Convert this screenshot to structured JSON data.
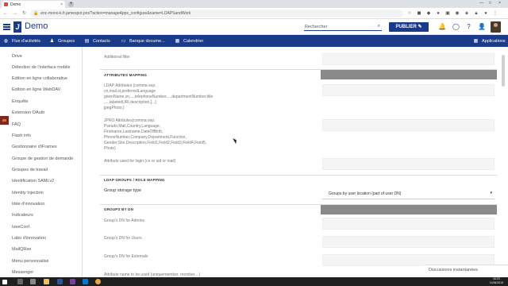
{
  "browser": {
    "tab_title": "Demo",
    "tab_close": "×",
    "new_tab": "+",
    "url": "enc-mono-k.fr.jamespot.pro/?action=manageApps_configure&name=LDAPSandWork",
    "controls": [
      "—",
      "□",
      "×"
    ]
  },
  "header": {
    "app_name": "Demo",
    "logo_letter": "J",
    "search_placeholder": "Rechercher",
    "publish_label": "PUBLIER"
  },
  "nav": {
    "items": [
      {
        "label": "Flux d'activités",
        "icon": "globe-icon"
      },
      {
        "label": "Groupes",
        "icon": "groups-icon"
      },
      {
        "label": "Contacts",
        "icon": "contacts-icon"
      },
      {
        "label": "Banque docume...",
        "icon": "folder-icon"
      },
      {
        "label": "Calendrier",
        "icon": "calendar-icon"
      }
    ],
    "apps_label": "Applications"
  },
  "sidebar": {
    "items": [
      "Drive",
      "Détection de l'interface mobile",
      "Edition en ligne collaborative",
      "Edition en ligne WebDAV",
      "Enquête",
      "Extension OAuth",
      "FAQ",
      "Flash info",
      "Gestionnaire d'iFrames",
      "Groupe de gestion de demande",
      "Groupes de travail",
      "Identification SAMLv2",
      "Identity Injection",
      "Idée d'innovation",
      "Indicateurs",
      "IzeeConf",
      "Labo d'innovation",
      "MailQRee",
      "Menu personnalisé",
      "Messenger"
    ]
  },
  "main": {
    "additional_filter": "Additional filter",
    "attributes_mapping": "ATTRIBUTES MAPPING",
    "ldap_attr_lines": [
      "LDAP Attributes (comma sep.",
      "cn,mail,st,preferredLanguage",
      "givenName,sn,...,telephoneNumber,...,departmentNumber,title",
      ",...,labeledURI,description,[...]",
      "jpegPhoto.)"
    ],
    "jpro_attr_lines": [
      "JPRO Attributes(comma sep.",
      "Pseudo,Mail,Country,Language,",
      "Firstname,Lastname,DateOfBirth,",
      "PhoneNumber,Company,Department,Function,",
      "Gender,Site,Description,Field1,Field2,Field3,Field4,Field5,",
      "Photo)"
    ],
    "login_attr": "Attribute used for login (cn or uid or mail)",
    "ldap_groups": "LDAP GROUPS / ROLE MAPPING",
    "group_storage_label": "Group storage type",
    "group_storage_value": "Groups by user location (part of user DN)",
    "groups_by_dn": "GROUPS BY DN",
    "dn_admins": "Group's DN for Admins",
    "dn_users": "Group's DN for Users",
    "dn_externals": "Group's DN for Externals",
    "last_label": "Attribute name to be used (uniquemember, member,...)"
  },
  "chat_label": "Discussions instantanées",
  "taskbar": {
    "time": "16:23",
    "date": "11/06/2019"
  }
}
